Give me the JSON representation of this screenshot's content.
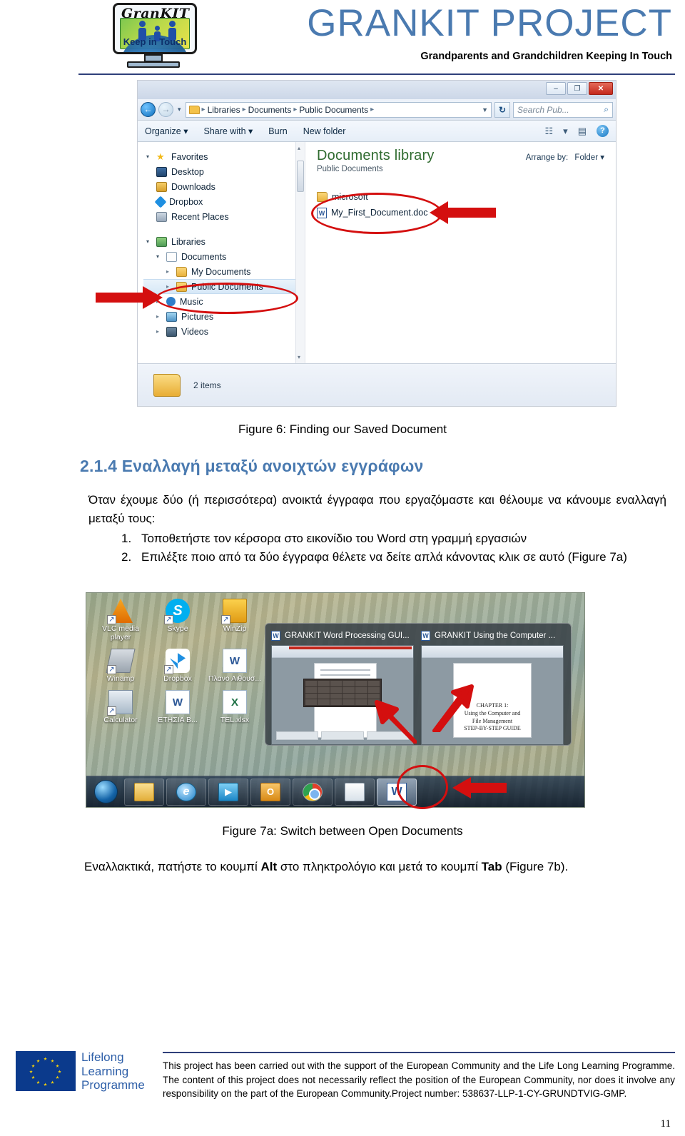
{
  "header": {
    "logo": {
      "brand": "GranKIT",
      "tagline": "Keep in Touch"
    },
    "project_title": "GRANKIT PROJECT",
    "project_subtitle": "Grandparents and Grandchildren Keeping In Touch",
    "title_color": "#4a7ab0"
  },
  "explorer": {
    "window_buttons": {
      "minimize": "–",
      "maximize": "❐",
      "close": "✕"
    },
    "nav_back": "←",
    "nav_forward": "→",
    "breadcrumb": [
      "Libraries",
      "Documents",
      "Public Documents"
    ],
    "breadcrumb_caret": "▼",
    "refresh_label": "↻",
    "search_placeholder": "Search Pub...",
    "search_icon": "⌕",
    "toolbar": {
      "organize": "Organize ▾",
      "share_with": "Share with ▾",
      "burn": "Burn",
      "new_folder": "New folder",
      "view_icon": "☷",
      "view_caret": "▾",
      "pane_icon": "▤",
      "help_icon": "?"
    },
    "nav_tree": [
      {
        "label": "Favorites",
        "level": 0,
        "icon": "star-icon",
        "tri": "▾",
        "selected": false
      },
      {
        "label": "Desktop",
        "level": 1,
        "icon": "desktop-icon",
        "tri": "",
        "selected": false
      },
      {
        "label": "Downloads",
        "level": 1,
        "icon": "downloads-icon",
        "tri": "",
        "selected": false
      },
      {
        "label": "Dropbox",
        "level": 1,
        "icon": "dropbox-icon",
        "tri": "",
        "selected": false
      },
      {
        "label": "Recent Places",
        "level": 1,
        "icon": "recent-places-icon",
        "tri": "",
        "selected": false
      },
      {
        "label": "Libraries",
        "level": 0,
        "icon": "libraries-icon",
        "tri": "▾",
        "selected": false
      },
      {
        "label": "Documents",
        "level": 1,
        "icon": "documents-icon",
        "tri": "▾",
        "selected": false
      },
      {
        "label": "My Documents",
        "level": 2,
        "icon": "folder-icon",
        "tri": "▸",
        "selected": false
      },
      {
        "label": "Public Documents",
        "level": 2,
        "icon": "folder-icon",
        "tri": "▸",
        "selected": true
      },
      {
        "label": "Music",
        "level": 1,
        "icon": "music-icon",
        "tri": "▸",
        "selected": false
      },
      {
        "label": "Pictures",
        "level": 1,
        "icon": "pictures-icon",
        "tri": "▸",
        "selected": false
      },
      {
        "label": "Videos",
        "level": 1,
        "icon": "videos-icon",
        "tri": "▸",
        "selected": false
      }
    ],
    "library_title": "Documents library",
    "library_subtitle": "Public Documents",
    "arrange_by_label": "Arrange by:",
    "arrange_by_value": "Folder ▾",
    "files": [
      {
        "name": "microsoft",
        "type": "folder"
      },
      {
        "name": "My_First_Document.doc",
        "type": "word"
      }
    ],
    "status_text": "2 items",
    "scroll_up": "▴",
    "scroll_down": "▾"
  },
  "figure6_caption": "Figure 6: Finding our Saved Document",
  "section": {
    "heading": "2.1.4 Εναλλαγή μεταξύ ανοιχτών εγγράφων",
    "intro": "Όταν έχουμε δύο (ή περισσότερα) ανοικτά έγγραφα που εργαζόμαστε και θέλουμε να κάνουμε εναλλαγή μεταξύ τους:",
    "steps": [
      {
        "num": "1.",
        "text": "Τοποθετήστε τον κέρσορα στο εικονίδιο του Word στη γραμμή εργασιών"
      },
      {
        "num": "2.",
        "text": "Επιλέξτε ποιο από τα δύο έγγραφα θέλετε να δείτε απλά κάνοντας κλικ σε αυτό (Figure 7a)"
      }
    ]
  },
  "desktop": {
    "icons": [
      {
        "label": "VLC media player",
        "icon": "vlc-icon"
      },
      {
        "label": "Skype",
        "icon": "skype-icon"
      },
      {
        "label": "WinZip",
        "icon": "winzip-icon"
      },
      {
        "label": "Winamp",
        "icon": "winamp-icon"
      },
      {
        "label": "Dropbox",
        "icon": "dropbox-icon"
      },
      {
        "label": "Πλανο Αιθουσ...",
        "icon": "word-doc-icon"
      },
      {
        "label": "Calculator",
        "icon": "calculator-icon"
      },
      {
        "label": "ΕΤΗΣΙΑ Β...",
        "icon": "word-doc-icon"
      },
      {
        "label": "TEL.xlsx",
        "icon": "excel-doc-icon"
      }
    ],
    "thumbnails": [
      {
        "title": "GRANKIT Word Processing GUI...",
        "app": "word"
      },
      {
        "title": "GRANKIT Using the Computer ...",
        "app": "word"
      }
    ],
    "thumbnail2_page_text": "CHAPTER 1:\nUsing the Computer and\nFile Management\nSTEP-BY-STEP GUIDE",
    "taskbar_items": [
      {
        "name": "start-orb",
        "glyph": ""
      },
      {
        "name": "windows-explorer",
        "glyph": ""
      },
      {
        "name": "internet-explorer",
        "glyph": "e"
      },
      {
        "name": "windows-media-player",
        "glyph": "▶"
      },
      {
        "name": "outlook",
        "glyph": "O"
      },
      {
        "name": "google-chrome",
        "glyph": ""
      },
      {
        "name": "paint",
        "glyph": ""
      },
      {
        "name": "microsoft-word",
        "glyph": "W"
      }
    ]
  },
  "figure7a_caption": "Figure 7a: Switch between Open Documents",
  "alt_tab_text": {
    "before": "Εναλλακτικά, πατήστε το κουμπί ",
    "key1": "Alt",
    "middle": " στο πληκτρολόγιο και μετά το κουμπί ",
    "key2": "Tab",
    "after": " (Figure 7b)."
  },
  "footer": {
    "llp_line1": "Lifelong",
    "llp_line2": "Learning",
    "llp_line3": "Programme",
    "disclaimer": "This project has been carried out with the support of the European Community and the Life Long Learning Programme. The content of this project does not necessarily reflect the position of the European Community, nor does it involve any responsibility on the part of the European Community.Project number: 538637-LLP-1-CY-GRUNDTVIG-GMP.",
    "page_number": "11"
  }
}
